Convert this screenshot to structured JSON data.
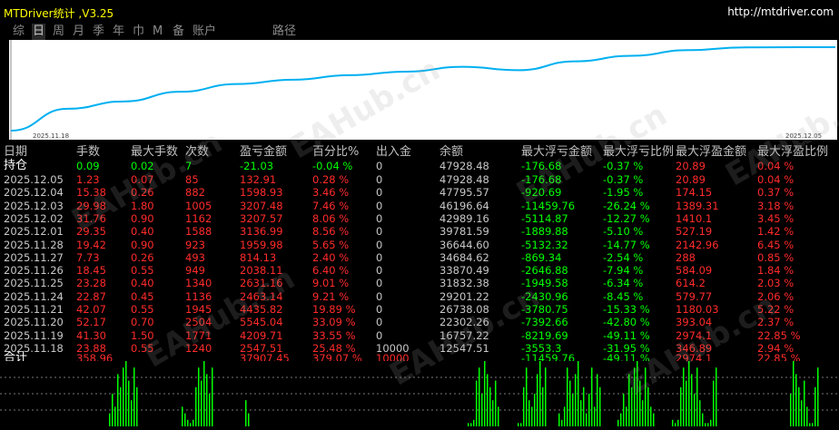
{
  "window": {
    "title": "MTDriver统计 ,V3.25",
    "url": "http://mtdriver.com"
  },
  "tabs": [
    {
      "label": "综",
      "active": false
    },
    {
      "label": "日",
      "active": true
    },
    {
      "label": "周",
      "active": false
    },
    {
      "label": "月",
      "active": false
    },
    {
      "label": "季",
      "active": false
    },
    {
      "label": "年",
      "active": false
    },
    {
      "label": "巾",
      "active": false
    },
    {
      "label": "M",
      "active": false
    },
    {
      "label": "备",
      "active": false
    },
    {
      "label": "账户",
      "active": false
    },
    {
      "label": "路径",
      "active": false
    }
  ],
  "equity_chart": {
    "start_date": "2025.11.18",
    "end_date": "2025.12.05",
    "curve_color": "#00b0f0",
    "values": [
      12547.51,
      16757.22,
      22302.26,
      26738.08,
      29201.22,
      31832.38,
      33870.49,
      36644.6,
      34684.62,
      39781.59,
      42989.16,
      46196.64,
      47795.57,
      47928.48
    ]
  },
  "watermark": "EAHub.cn",
  "table": {
    "headers": [
      "日期",
      "手数",
      "最大手数",
      "次数",
      "盈亏金额",
      "百分比%",
      "出入金",
      "余额",
      "最大浮亏金额",
      "最大浮亏比例",
      "最大浮盈金额",
      "最大浮盈比例"
    ],
    "holding": {
      "label": "持仓",
      "lots": "0.09",
      "maxlots": "0.02",
      "count": "7",
      "pnl": "-21.03",
      "pct": "-0.04 %",
      "flow": "0",
      "balance": "47928.48",
      "fl_amt": "-176.68",
      "fl_pct": "-0.37 %",
      "fp_amt": "20.89",
      "fp_pct": "0.04 %"
    },
    "rows": [
      {
        "date": "2025.12.05",
        "lots": "1.23",
        "maxlots": "0.07",
        "count": "85",
        "pnl": "132.91",
        "pct": "0.28 %",
        "flow": "0",
        "balance": "47928.48",
        "fl_amt": "-176.68",
        "fl_pct": "-0.37 %",
        "fp_amt": "20.89",
        "fp_pct": "0.04 %"
      },
      {
        "date": "2025.12.04",
        "lots": "15.38",
        "maxlots": "0.26",
        "count": "882",
        "pnl": "1598.93",
        "pct": "3.46 %",
        "flow": "0",
        "balance": "47795.57",
        "fl_amt": "-920.69",
        "fl_pct": "-1.95 %",
        "fp_amt": "174.15",
        "fp_pct": "0.37 %"
      },
      {
        "date": "2025.12.03",
        "lots": "29.98",
        "maxlots": "1.80",
        "count": "1005",
        "pnl": "3207.48",
        "pct": "7.46 %",
        "flow": "0",
        "balance": "46196.64",
        "fl_amt": "-11459.76",
        "fl_pct": "-26.24 %",
        "fp_amt": "1389.31",
        "fp_pct": "3.18 %"
      },
      {
        "date": "2025.12.02",
        "lots": "31.76",
        "maxlots": "0.90",
        "count": "1162",
        "pnl": "3207.57",
        "pct": "8.06 %",
        "flow": "0",
        "balance": "42989.16",
        "fl_amt": "-5114.87",
        "fl_pct": "-12.27 %",
        "fp_amt": "1410.1",
        "fp_pct": "3.45 %"
      },
      {
        "date": "2025.12.01",
        "lots": "29.35",
        "maxlots": "0.40",
        "count": "1588",
        "pnl": "3136.99",
        "pct": "8.56 %",
        "flow": "0",
        "balance": "39781.59",
        "fl_amt": "-1889.88",
        "fl_pct": "-5.10 %",
        "fp_amt": "527.19",
        "fp_pct": "1.42 %"
      },
      {
        "date": "2025.11.28",
        "lots": "19.42",
        "maxlots": "0.90",
        "count": "923",
        "pnl": "1959.98",
        "pct": "5.65 %",
        "flow": "0",
        "balance": "36644.60",
        "fl_amt": "-5132.32",
        "fl_pct": "-14.77 %",
        "fp_amt": "2142.96",
        "fp_pct": "6.45 %"
      },
      {
        "date": "2025.11.27",
        "lots": "7.73",
        "maxlots": "0.26",
        "count": "493",
        "pnl": "814.13",
        "pct": "2.40 %",
        "flow": "0",
        "balance": "34684.62",
        "fl_amt": "-869.34",
        "fl_pct": "-2.54 %",
        "fp_amt": "288",
        "fp_pct": "0.85 %"
      },
      {
        "date": "2025.11.26",
        "lots": "18.45",
        "maxlots": "0.55",
        "count": "949",
        "pnl": "2038.11",
        "pct": "6.40 %",
        "flow": "0",
        "balance": "33870.49",
        "fl_amt": "-2646.88",
        "fl_pct": "-7.94 %",
        "fp_amt": "584.09",
        "fp_pct": "1.84 %"
      },
      {
        "date": "2025.11.25",
        "lots": "23.28",
        "maxlots": "0.40",
        "count": "1340",
        "pnl": "2631.16",
        "pct": "9.01 %",
        "flow": "0",
        "balance": "31832.38",
        "fl_amt": "-1949.58",
        "fl_pct": "-6.34 %",
        "fp_amt": "614.2",
        "fp_pct": "2.03 %"
      },
      {
        "date": "2025.11.24",
        "lots": "22.87",
        "maxlots": "0.45",
        "count": "1136",
        "pnl": "2463.14",
        "pct": "9.21 %",
        "flow": "0",
        "balance": "29201.22",
        "fl_amt": "-2430.96",
        "fl_pct": "-8.45 %",
        "fp_amt": "579.77",
        "fp_pct": "2.06 %"
      },
      {
        "date": "2025.11.21",
        "lots": "42.07",
        "maxlots": "0.55",
        "count": "1945",
        "pnl": "4435.82",
        "pct": "19.89 %",
        "flow": "0",
        "balance": "26738.08",
        "fl_amt": "-3780.75",
        "fl_pct": "-15.33 %",
        "fp_amt": "1180.03",
        "fp_pct": "5.22 %"
      },
      {
        "date": "2025.11.20",
        "lots": "52.17",
        "maxlots": "0.70",
        "count": "2504",
        "pnl": "5545.04",
        "pct": "33.09 %",
        "flow": "0",
        "balance": "22302.26",
        "fl_amt": "-7392.66",
        "fl_pct": "-42.80 %",
        "fp_amt": "393.04",
        "fp_pct": "2.37 %"
      },
      {
        "date": "2025.11.19",
        "lots": "41.30",
        "maxlots": "1.50",
        "count": "1771",
        "pnl": "4209.71",
        "pct": "33.55 %",
        "flow": "0",
        "balance": "16757.22",
        "fl_amt": "-8219.69",
        "fl_pct": "-49.11 %",
        "fp_amt": "2974.1",
        "fp_pct": "22.85 %"
      },
      {
        "date": "2025.11.18",
        "lots": "23.88",
        "maxlots": "0.55",
        "count": "1240",
        "pnl": "2547.51",
        "pct": "25.48 %",
        "flow": "10000",
        "balance": "12547.51",
        "fl_amt": "-3553.3",
        "fl_pct": "-31.95 %",
        "fp_amt": "346.89",
        "fp_pct": "2.94 %"
      }
    ],
    "total": {
      "label": "合计",
      "lots": "358.96",
      "maxlots": "",
      "count": "",
      "pnl": "37907.45",
      "pct": "379.07 %",
      "flow": "10000",
      "balance": "",
      "fl_amt": "-11459.76",
      "fl_pct": "-49.11 %",
      "fp_amt": "2974.1",
      "fp_pct": "22.85 %"
    }
  },
  "volume_chart": {
    "bar_color": "#00ff00",
    "values": [
      0.2,
      0.5,
      0.3,
      0.8,
      0.6,
      0.9,
      1,
      0.7,
      0.4,
      0.9,
      0.6,
      0.3,
      0.2,
      0.1,
      0.05,
      0.1,
      0.6,
      0.9,
      0.7,
      1,
      0.8,
      0.5,
      0.9,
      0.4,
      0.2,
      0.05,
      0.05,
      0.1,
      0.7,
      0.9,
      0.5,
      1,
      0.8,
      0.6,
      0.4,
      0.7,
      0.3,
      0.05,
      0.05,
      0.6,
      0.9,
      0.4,
      0.3,
      0.5,
      0.8,
      1,
      0.6,
      0.9,
      0.2,
      0.1,
      0.3,
      0.9,
      0.7,
      0.5,
      0.8,
      1,
      0.4,
      0.6,
      0.2,
      0.5,
      0.9,
      0.3,
      0.8,
      0.6,
      0.1
    ]
  }
}
